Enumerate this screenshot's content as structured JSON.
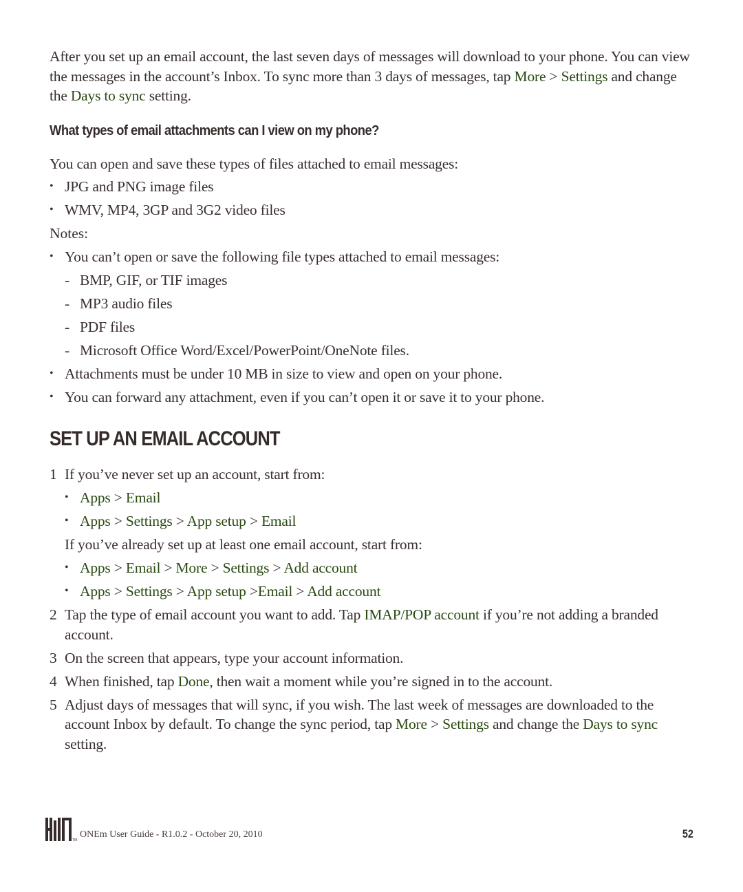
{
  "intro": {
    "t1": "After you set up an email account, the last seven days of messages will download to your phone. You can view the messages in the account’s Inbox. To sync more than 3 days of messages, tap ",
    "l1": "More",
    "t2": " > ",
    "l2": "Settings",
    "t3": " and change the ",
    "l3": "Days to sync",
    "t4": " setting."
  },
  "faq": {
    "heading": "What types of email attachments can I view on my phone?",
    "lead": "You can open and save these types of files attached to email messages:",
    "supported": [
      "JPG and PNG image files",
      "WMV, MP4, 3GP and 3G2 video files"
    ],
    "notes_label": "Notes:",
    "note1": "You can’t open or save the following file types attached to email messages:",
    "unsupported": [
      "BMP, GIF, or TIF images",
      "MP3 audio files",
      "PDF files",
      "Microsoft Office Word/Excel/PowerPoint/OneNote files."
    ],
    "note2": "Attachments must be under 10 MB in size to view and open on your phone.",
    "note3": "You can forward any attachment, even if you can’t open it or save it to your phone."
  },
  "setup": {
    "title": "SET UP AN EMAIL ACCOUNT",
    "step1": {
      "num": "1",
      "text": "If you’ve never set up an account, start from:",
      "paths_new": [
        [
          "Apps",
          "Email"
        ],
        [
          "Apps",
          "Settings",
          "App setup",
          "Email"
        ]
      ],
      "text2": "If you’ve already set up at least one email account, start from:",
      "paths_existing": [
        [
          "Apps",
          "Email",
          "More",
          "Settings",
          "Add account"
        ],
        [
          "Apps",
          "Settings",
          "App setup",
          "Email",
          "Add account"
        ]
      ]
    },
    "step2": {
      "num": "2",
      "t1": "Tap the type of email account you want to add. Tap ",
      "l1": "IMAP/POP account",
      "t2": " if you’re not adding a branded account."
    },
    "step3": {
      "num": "3",
      "t1": "On the screen that appears, type your account information."
    },
    "step4": {
      "num": "4",
      "t1": "When finished, tap ",
      "l1": "Done",
      "t2": ", then wait a moment while you’re signed in to the account."
    },
    "step5": {
      "num": "5",
      "t1": "Adjust days of messages that will sync, if you wish. The last week of messages are downloaded to the account Inbox by default. To change the sync period, tap ",
      "l1": "More",
      "t2": " > ",
      "l2": "Settings",
      "t3": " and change the ",
      "l3": "Days to sync",
      "t4": " setting."
    }
  },
  "footer": {
    "text": "ONEm User Guide - R1.0.2 - October 20, 2010",
    "page": "52",
    "tm": "TM"
  },
  "colors": {
    "link": "#2a4a12",
    "text": "#3a2f2f"
  }
}
